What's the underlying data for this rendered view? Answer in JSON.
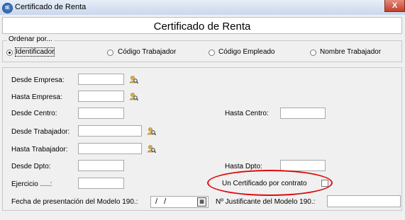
{
  "window": {
    "title": "Certificado de Renta",
    "app_icon_text": "IE",
    "close_glyph": "X"
  },
  "form": {
    "title": "Certificado de Renta"
  },
  "order": {
    "legend": "Ordenar por...",
    "options": [
      {
        "label": "Identificador",
        "checked": true
      },
      {
        "label": "Código Trabajador",
        "checked": false
      },
      {
        "label": "Código Empleado",
        "checked": false
      },
      {
        "label": "Nombre Trabajador",
        "checked": false
      }
    ]
  },
  "fields": {
    "desde_empresa": {
      "label": "Desde Empresa:",
      "value": ""
    },
    "hasta_empresa": {
      "label": "Hasta Empresa:",
      "value": ""
    },
    "desde_centro": {
      "label": "Desde Centro:",
      "value": ""
    },
    "hasta_centro": {
      "label": "Hasta Centro:",
      "value": ""
    },
    "desde_trabajador": {
      "label": "Desde Trabajador:",
      "value": ""
    },
    "hasta_trabajador": {
      "label": "Hasta Trabajador:",
      "value": ""
    },
    "desde_dpto": {
      "label": "Desde Dpto:",
      "value": ""
    },
    "hasta_dpto": {
      "label": "Hasta Dpto:",
      "value": ""
    },
    "ejercicio": {
      "label": "Ejercicio .....:",
      "value": ""
    },
    "certificado_contrato": {
      "label": "Un Certificado por contrato",
      "checked": false
    },
    "fecha_presentacion": {
      "label": "Fecha de presentación del Modelo 190.:",
      "value": "/ /"
    },
    "justificante": {
      "label": "Nº Justificante del Modelo 190.:",
      "value": ""
    }
  },
  "icons": {
    "lookup": "search-person-icon",
    "calendar": "calendar-icon"
  },
  "colors": {
    "highlight_ellipse": "#dd0b0b",
    "titlebar": "#c9d8ec",
    "background": "#f0f0f0"
  }
}
